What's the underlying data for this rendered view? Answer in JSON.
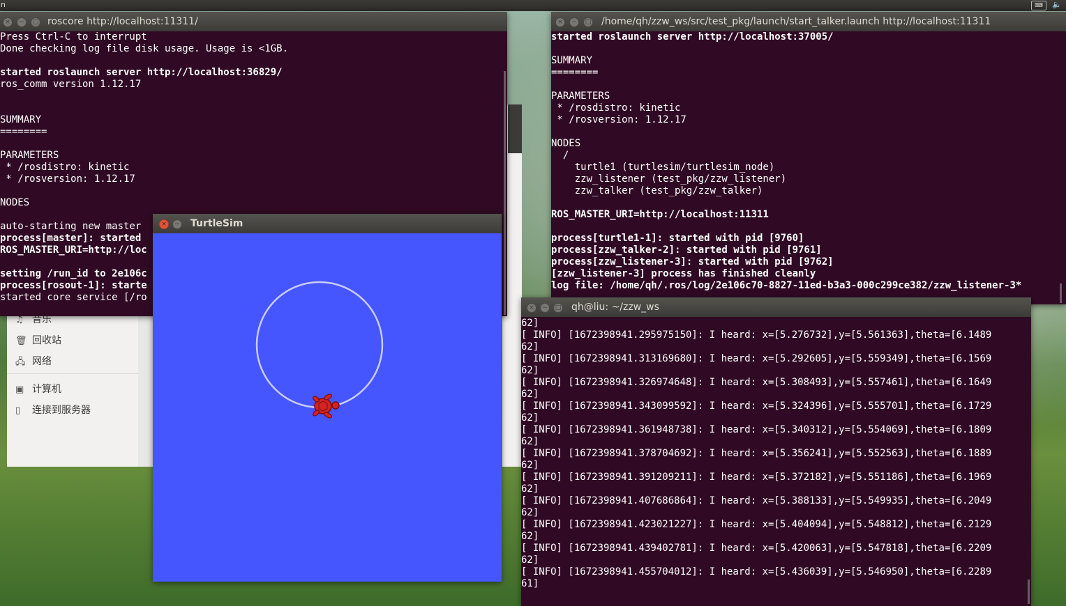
{
  "topbar": {
    "left_letter": "n",
    "keyboard_label": "⌨",
    "sound_label": "🔈"
  },
  "colors": {
    "terminal_bg": "#300a24",
    "turtle_bg": "#4556ff",
    "close_red": "#e1553a"
  },
  "roscore": {
    "title": "roscore http://localhost:11311/",
    "lines": [
      {
        "t": "Press Ctrl-C to interrupt",
        "b": false
      },
      {
        "t": "Done checking log file disk usage. Usage is <1GB.",
        "b": false
      },
      {
        "t": "",
        "b": false
      },
      {
        "t": "started roslaunch server http://localhost:36829/",
        "b": true
      },
      {
        "t": "ros_comm version 1.12.17",
        "b": false
      },
      {
        "t": "",
        "b": false
      },
      {
        "t": "",
        "b": false
      },
      {
        "t": "SUMMARY",
        "b": false
      },
      {
        "t": "========",
        "b": false
      },
      {
        "t": "",
        "b": false
      },
      {
        "t": "PARAMETERS",
        "b": false
      },
      {
        "t": " * /rosdistro: kinetic",
        "b": false
      },
      {
        "t": " * /rosversion: 1.12.17",
        "b": false
      },
      {
        "t": "",
        "b": false
      },
      {
        "t": "NODES",
        "b": false
      },
      {
        "t": "",
        "b": false
      },
      {
        "t": "auto-starting new master",
        "b": false
      },
      {
        "t": "process[master]: started",
        "b": true
      },
      {
        "t": "ROS_MASTER_URI=http://loc",
        "b": true
      },
      {
        "t": "",
        "b": false
      },
      {
        "t": "setting /run_id to 2e106c",
        "b": true
      },
      {
        "t": "process[rosout-1]: starte",
        "b": true
      },
      {
        "t": "started core service [/ro",
        "b": false
      }
    ]
  },
  "launch": {
    "title": "/home/qh/zzw_ws/src/test_pkg/launch/start_talker.launch http://localhost:11311",
    "lines": [
      {
        "t": "started roslaunch server http://localhost:37005/",
        "b": true
      },
      {
        "t": "",
        "b": false
      },
      {
        "t": "SUMMARY",
        "b": false
      },
      {
        "t": "========",
        "b": false
      },
      {
        "t": "",
        "b": false
      },
      {
        "t": "PARAMETERS",
        "b": false
      },
      {
        "t": " * /rosdistro: kinetic",
        "b": false
      },
      {
        "t": " * /rosversion: 1.12.17",
        "b": false
      },
      {
        "t": "",
        "b": false
      },
      {
        "t": "NODES",
        "b": false
      },
      {
        "t": "  /",
        "b": false
      },
      {
        "t": "    turtle1 (turtlesim/turtlesim_node)",
        "b": false
      },
      {
        "t": "    zzw_listener (test_pkg/zzw_listener)",
        "b": false
      },
      {
        "t": "    zzw_talker (test_pkg/zzw_talker)",
        "b": false
      },
      {
        "t": "",
        "b": false
      },
      {
        "t": "ROS_MASTER_URI=http://localhost:11311",
        "b": true
      },
      {
        "t": "",
        "b": false
      },
      {
        "t": "process[turtle1-1]: started with pid [9760]",
        "b": true
      },
      {
        "t": "process[zzw_talker-2]: started with pid [9761]",
        "b": true
      },
      {
        "t": "process[zzw_listener-3]: started with pid [9762]",
        "b": true
      },
      {
        "t": "[zzw_listener-3] process has finished cleanly",
        "b": true
      },
      {
        "t": "log file: /home/qh/.ros/log/2e106c70-8827-11ed-b3a3-000c299ce382/zzw_listener-3*",
        "b": true
      }
    ]
  },
  "listener": {
    "title": "qh@liu: ~/zzw_ws",
    "lines": [
      "62]",
      "[ INFO] [1672398941.295975150]: I heard: x=[5.276732],y=[5.561363],theta=[6.1489",
      "62]",
      "[ INFO] [1672398941.313169680]: I heard: x=[5.292605],y=[5.559349],theta=[6.1569",
      "62]",
      "[ INFO] [1672398941.326974648]: I heard: x=[5.308493],y=[5.557461],theta=[6.1649",
      "62]",
      "[ INFO] [1672398941.343099592]: I heard: x=[5.324396],y=[5.555701],theta=[6.1729",
      "62]",
      "[ INFO] [1672398941.361948738]: I heard: x=[5.340312],y=[5.554069],theta=[6.1809",
      "62]",
      "[ INFO] [1672398941.378704692]: I heard: x=[5.356241],y=[5.552563],theta=[6.1889",
      "62]",
      "[ INFO] [1672398941.391209211]: I heard: x=[5.372182],y=[5.551186],theta=[6.1969",
      "62]",
      "[ INFO] [1672398941.407686864]: I heard: x=[5.388133],y=[5.549935],theta=[6.2049",
      "62]",
      "[ INFO] [1672398941.423021227]: I heard: x=[5.404094],y=[5.548812],theta=[6.2129",
      "62]",
      "[ INFO] [1672398941.439402781]: I heard: x=[5.420063],y=[5.547818],theta=[6.2209",
      "62]",
      "[ INFO] [1672398941.455704012]: I heard: x=[5.436039],y=[5.546950],theta=[6.2289",
      "61]"
    ]
  },
  "turtlesim": {
    "title": "TurtleSim"
  },
  "file_manager": {
    "items": [
      {
        "label": "音乐",
        "icon": "music-icon"
      },
      {
        "label": "回收站",
        "icon": "trash-icon"
      },
      {
        "label": "网络",
        "icon": "network-icon"
      },
      {
        "label": "计算机",
        "icon": "computer-icon"
      },
      {
        "label": "连接到服务器",
        "icon": "server-icon"
      }
    ]
  }
}
